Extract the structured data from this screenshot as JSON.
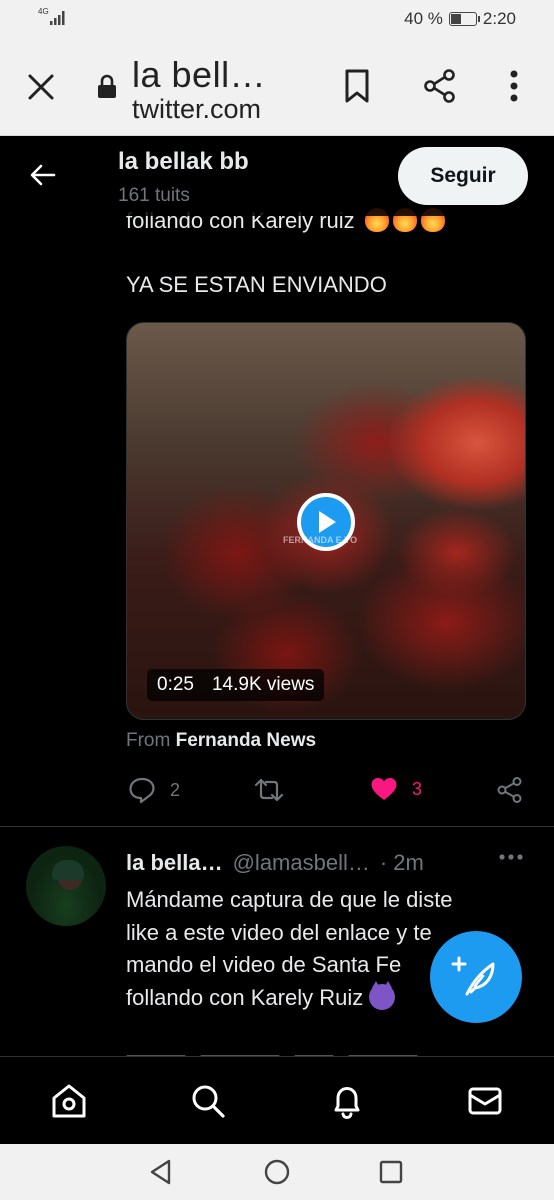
{
  "status_bar": {
    "network": "4G",
    "battery_text": "40 %",
    "battery_level": 0.4,
    "time": "2:20"
  },
  "browser": {
    "title": "la bell…",
    "url": "twitter.com"
  },
  "profile_header": {
    "name": "la bellak bb",
    "tweet_count": "161 tuits",
    "follow_label": "Seguir"
  },
  "tweet1": {
    "partial_text": "follando con Karely ruiz",
    "text_line": "YA SE ESTAN ENVIANDO",
    "video": {
      "duration": "0:25",
      "views": "14.9K views",
      "watermark": "FERNANDA E.YO"
    },
    "from_prefix": "From",
    "from_source": "Fernanda News",
    "actions": {
      "replies": "2",
      "likes": "3"
    }
  },
  "tweet2": {
    "author_name": "la bella…",
    "handle": "@lamasbell…",
    "time": "· 2m",
    "text_line1": "Mándame captura de que le diste",
    "text_line2": "like a este video del enlace y te",
    "text_line3": "mando el video de Santa Fe",
    "text_line4": "follando con Karely Ruiz"
  },
  "colors": {
    "accent": "#1d9bf0",
    "like": "#f91880",
    "background": "#000000",
    "muted": "#71767b"
  }
}
